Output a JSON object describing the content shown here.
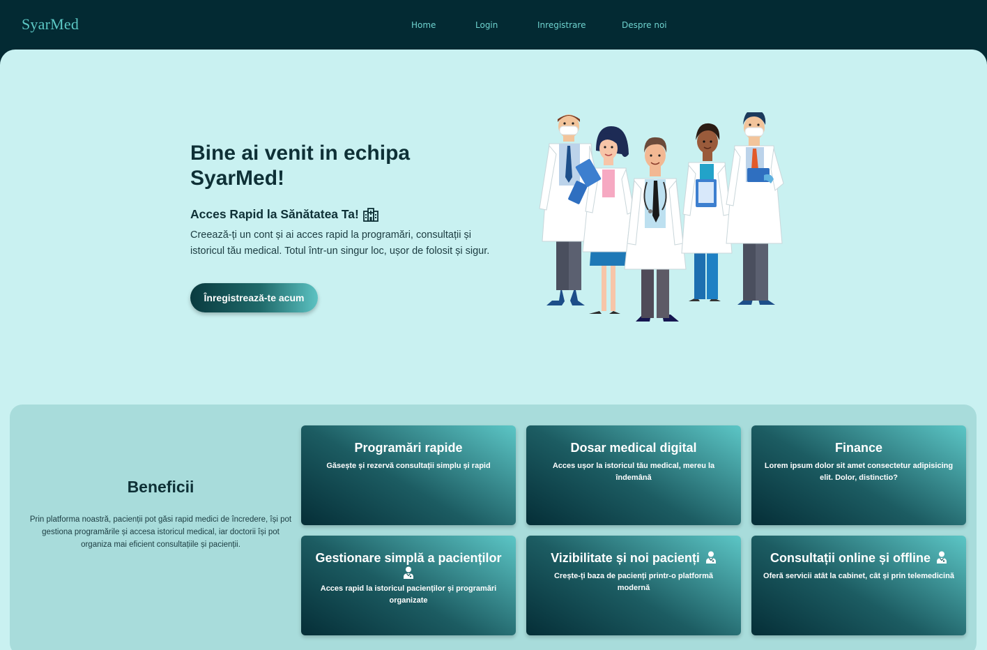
{
  "header": {
    "logo": "SyarMed",
    "nav": [
      {
        "label": "Home"
      },
      {
        "label": "Login"
      },
      {
        "label": "Inregistrare"
      },
      {
        "label": "Despre noi"
      }
    ]
  },
  "hero": {
    "title": "Bine ai venit in echipa SyarMed!",
    "subtitle": "Acces Rapid la Sănătatea Ta!",
    "subtitle_icon": "hospital-icon",
    "text": "Creează-ți un cont și ai acces rapid la programări, consultații și istoricul tău medical. Totul într-un singur loc, ușor de folosit și sigur.",
    "cta_label": "Înregistrează-te acum",
    "illustration": "doctors-team-illustration"
  },
  "benefits": {
    "title": "Beneficii",
    "text": "Prin platforma noastră, pacienții pot găsi rapid medici de încredere, își pot gestiona programările și accesa istoricul medical, iar doctorii își pot organiza mai eficient consultațiile și pacienții.",
    "cards": [
      {
        "title": "Programări rapide",
        "text": "Găsește și rezervă consultații simplu și rapid"
      },
      {
        "title": "Dosar medical digital",
        "text": "Acces ușor la istoricul tău medical, mereu la îndemână"
      },
      {
        "title": "Finance",
        "text": "Lorem ipsum dolor sit amet consectetur adipisicing elit. Dolor, distinctio?"
      },
      {
        "title": "Gestionare simplă a pacienților",
        "text": "Acces rapid la istoricul pacienților și programări organizate",
        "icon": "doctor-icon"
      },
      {
        "title": "Vizibilitate și noi pacienți",
        "text": "Crește-ți baza de pacienți printr-o platformă modernă",
        "icon": "doctor-icon"
      },
      {
        "title": "Consultații online și offline",
        "text": "Oferă servicii atât la cabinet, cât și prin telemedicină",
        "icon": "doctor-icon"
      }
    ]
  },
  "colors": {
    "header_bg": "#032a33",
    "logo": "#5cc7c4",
    "nav_link": "#6fd3cf",
    "page_bg": "#c9f1f1",
    "benefits_bg": "#a8dcdb",
    "card_gradient_dark": "#052e37",
    "card_gradient_light": "#5cc6c6",
    "text_dark": "#0e3036"
  }
}
